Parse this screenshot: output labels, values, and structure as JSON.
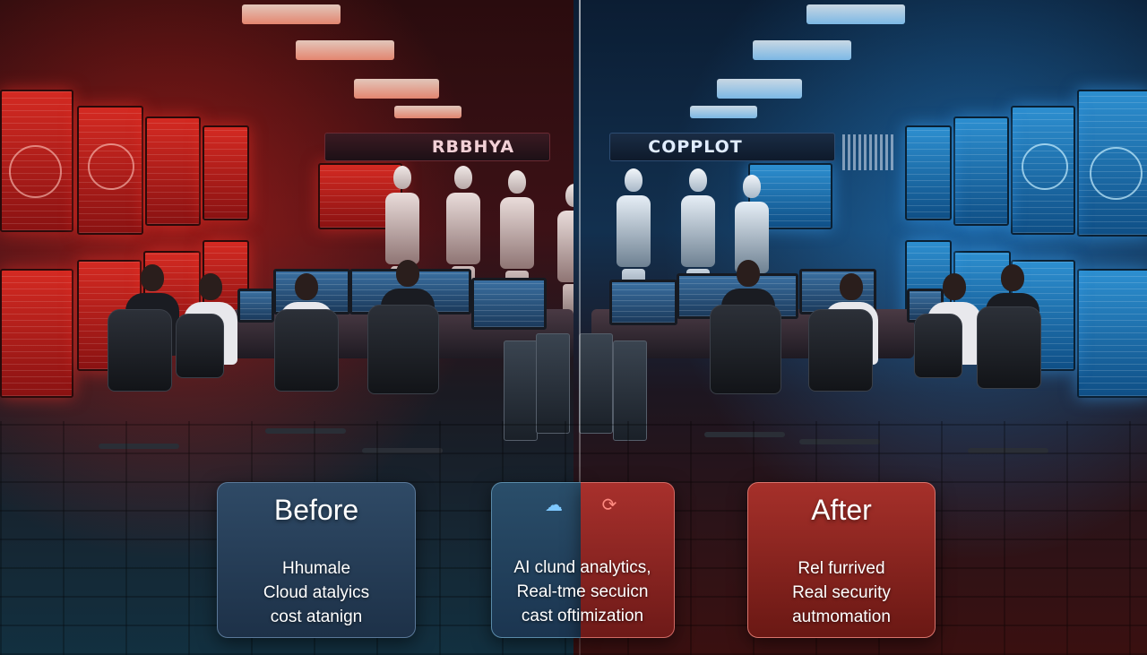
{
  "header": {
    "left_sign": "RBBHYA",
    "right_sign": "COPPLOT"
  },
  "before_card": {
    "title": "Before",
    "lines": [
      "Hhumale",
      "Cloud atalyics",
      "cost atanign"
    ]
  },
  "middle_card": {
    "lines": [
      "AI clund analytics,",
      "Real-tme secuicn",
      "cast oftimization"
    ],
    "left_icon": "cloud-icon",
    "right_icon": "cycle-arrows-icon"
  },
  "after_card": {
    "title": "After",
    "lines": [
      "Rel furrived",
      "Real security",
      "autmomation"
    ]
  },
  "colors": {
    "left_theme": "#d42a22",
    "right_theme": "#2d8fd0",
    "before_card": "#2f4a66",
    "after_card": "#a6302a"
  }
}
